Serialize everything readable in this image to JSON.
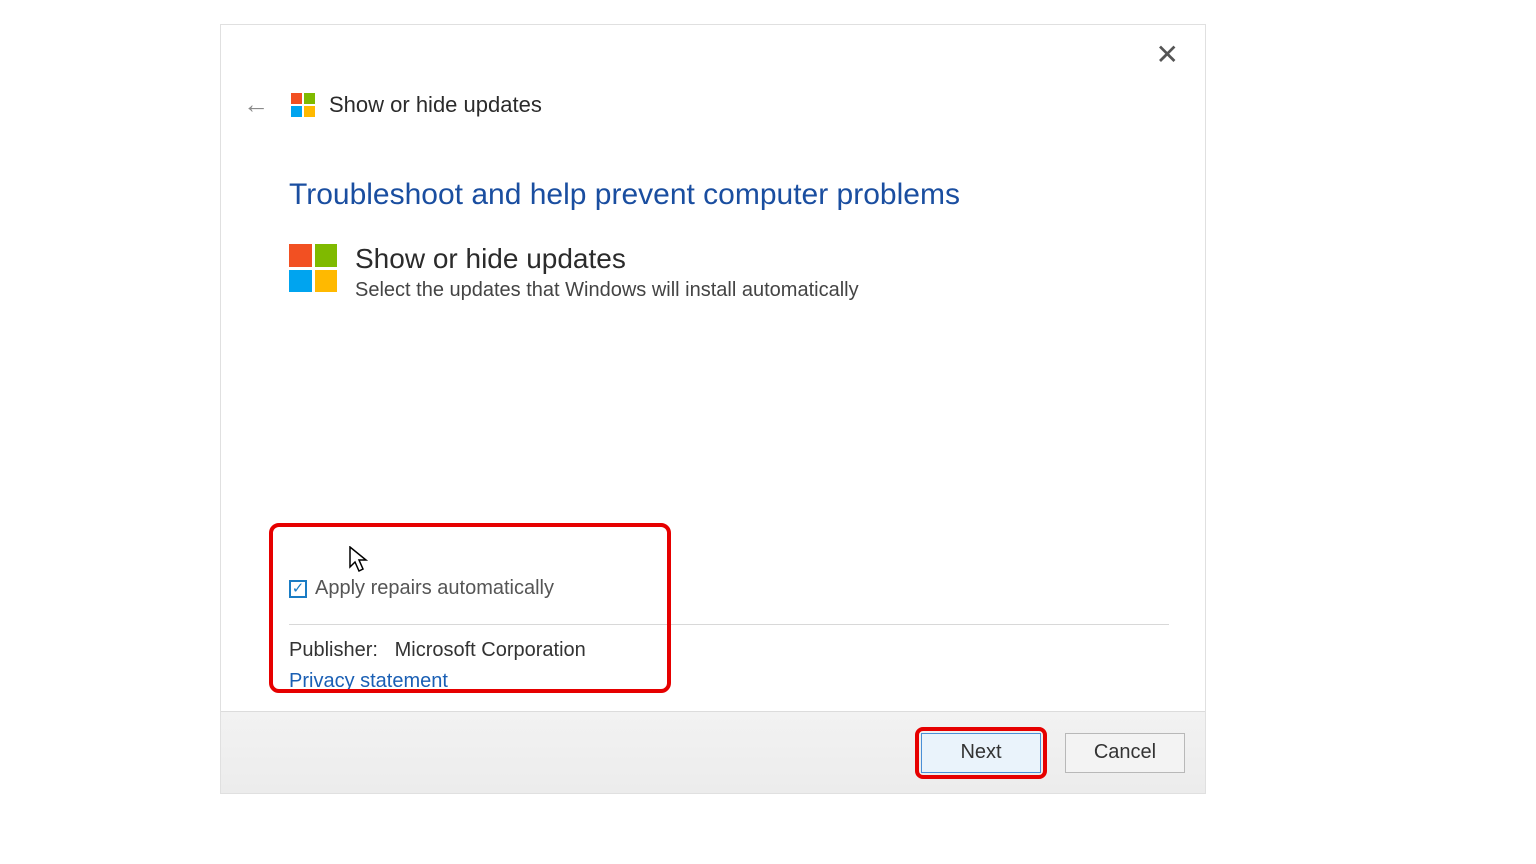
{
  "window": {
    "title": "Show or hide updates"
  },
  "content": {
    "heading": "Troubleshoot and help prevent computer problems",
    "app_title": "Show or hide updates",
    "app_desc": "Select the updates that Windows will install automatically"
  },
  "options": {
    "repair_label": "Apply repairs automatically",
    "repair_checked": true,
    "publisher_label": "Publisher:",
    "publisher_value": "Microsoft Corporation",
    "privacy_link": "Privacy statement"
  },
  "footer": {
    "next_label": "Next",
    "cancel_label": "Cancel"
  }
}
